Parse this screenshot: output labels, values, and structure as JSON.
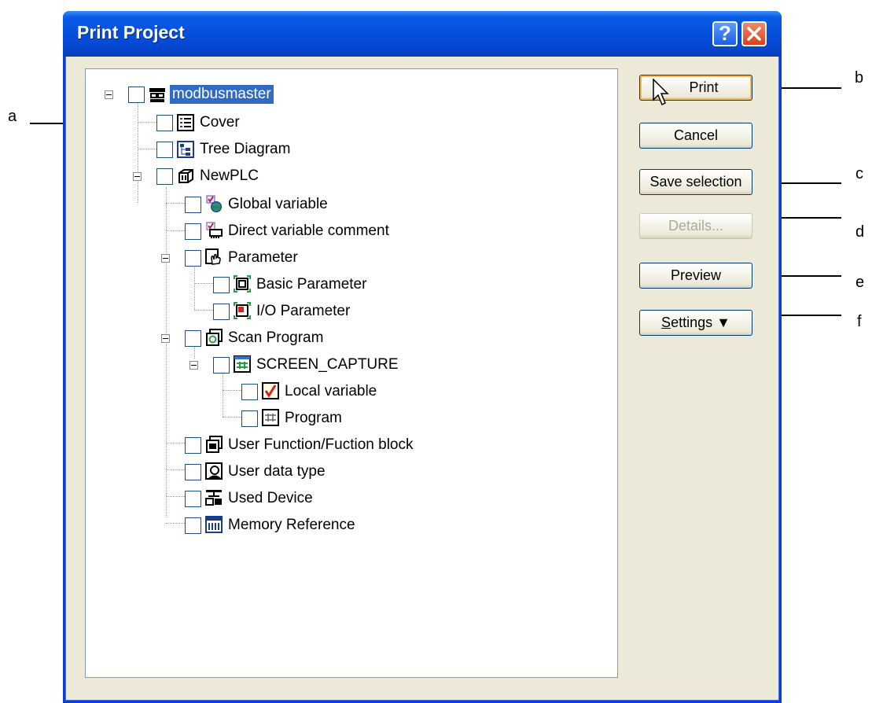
{
  "window": {
    "title": "Print Project",
    "help_symbol": "?",
    "close_icon": "close-icon"
  },
  "tree": {
    "root": {
      "label": "modbusmaster",
      "icon": "project-icon",
      "selected": true
    },
    "items": [
      {
        "label": "Cover",
        "icon": "cover-icon"
      },
      {
        "label": "Tree Diagram",
        "icon": "tree-diagram-icon"
      },
      {
        "label": "NewPLC",
        "icon": "plc-icon"
      },
      {
        "label": "Global variable",
        "icon": "global-variable-icon"
      },
      {
        "label": "Direct variable comment",
        "icon": "direct-variable-icon"
      },
      {
        "label": "Parameter",
        "icon": "parameter-icon"
      },
      {
        "label": "Basic Parameter",
        "icon": "basic-parameter-icon"
      },
      {
        "label": "I/O Parameter",
        "icon": "io-parameter-icon"
      },
      {
        "label": "Scan Program",
        "icon": "scan-program-icon"
      },
      {
        "label": "SCREEN_CAPTURE",
        "icon": "program-block-icon"
      },
      {
        "label": "Local variable",
        "icon": "local-variable-icon"
      },
      {
        "label": "Program",
        "icon": "program-icon"
      },
      {
        "label": "User Function/Fuction block",
        "icon": "user-function-icon"
      },
      {
        "label": "User data type",
        "icon": "user-data-type-icon"
      },
      {
        "label": "Used Device",
        "icon": "used-device-icon"
      },
      {
        "label": "Memory Reference",
        "icon": "memory-reference-icon"
      }
    ]
  },
  "buttons": {
    "print": "Print",
    "cancel": "Cancel",
    "save_selection": "Save selection",
    "details": "Details...",
    "preview": "Preview",
    "settings": "Settings",
    "settings_arrow": "▼"
  },
  "annotations": {
    "a": "a",
    "b": "b",
    "c": "c",
    "d": "d",
    "e": "e",
    "f": "f"
  }
}
